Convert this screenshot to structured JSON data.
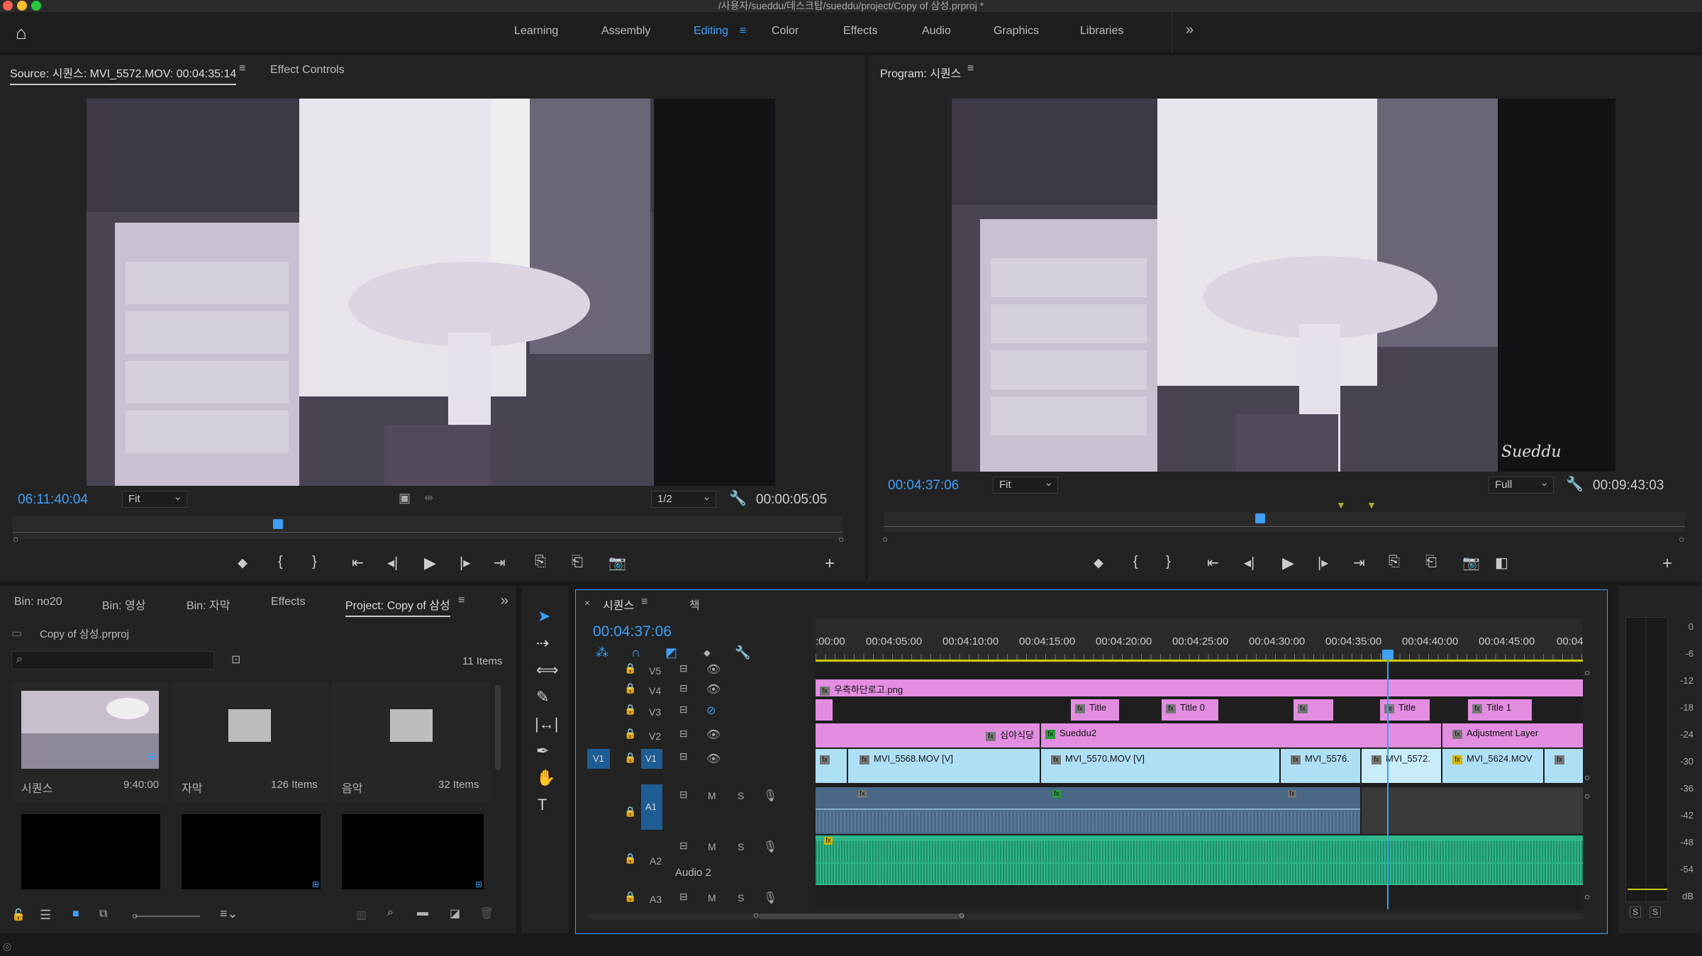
{
  "window": {
    "title": "/사용자/sueddu/데스크탑/sueddu/project/Copy of 삼성.prproj *"
  },
  "workspaces": [
    "Learning",
    "Assembly",
    "Editing",
    "Color",
    "Effects",
    "Audio",
    "Graphics",
    "Libraries"
  ],
  "active_workspace": "Editing",
  "source": {
    "tab_label": "Source: 시퀀스: MVI_5572.MOV: 00:04:35:14",
    "effect_controls_tab": "Effect Controls",
    "timecode": "06:11:40:04",
    "fit": "Fit",
    "resolution": "1/2",
    "duration": "00:00:05:05",
    "playhead_fraction": 0.32
  },
  "program": {
    "tab_label": "Program: 시퀀스",
    "timecode": "00:04:37:06",
    "fit": "Fit",
    "resolution": "Full",
    "duration": "00:09:43:03",
    "playhead_fraction": 0.47,
    "watermark": "Sueddu"
  },
  "project": {
    "tabs": [
      "Bin: no20",
      "Bin: 영상",
      "Bin: 자막",
      "Effects",
      "Project: Copy of 삼성"
    ],
    "active_tab": "Project: Copy of 삼성",
    "file_name": "Copy of 삼성.prproj",
    "search_placeholder": "",
    "item_count": "11 Items",
    "items": [
      {
        "name": "시퀀스",
        "meta": "9:40:00",
        "kind": "sequence"
      },
      {
        "name": "자막",
        "meta": "126 Items",
        "kind": "folder"
      },
      {
        "name": "음악",
        "meta": "32 Items",
        "kind": "folder"
      }
    ]
  },
  "timeline": {
    "tabs": [
      "시퀀스",
      "책"
    ],
    "timecode": "00:04:37:06",
    "ruler": [
      ":00:00",
      "00:04:05:00",
      "00:04:10:00",
      "00:04:15:00",
      "00:04:20:00",
      "00:04:25:00",
      "00:04:30:00",
      "00:04:35:00",
      "00:04:40:00",
      "00:04:45:00",
      "00:04"
    ],
    "tracks": {
      "video": [
        "V5",
        "V4",
        "V3",
        "V2",
        "V1"
      ],
      "audio": [
        "A1",
        "A2",
        "A3"
      ],
      "source_patch": "V1",
      "audio2_name": "Audio 2"
    },
    "clips": {
      "v4": "우측하단로고.png",
      "v3": [
        "Title",
        "Title 0",
        "Title",
        "Title 1"
      ],
      "v2": [
        "심야식당",
        "Sueddu2",
        "Adjustment Layer"
      ],
      "v1": [
        "MVI_5568.MOV [V]",
        "MVI_5570.MOV [V]",
        "MVI_5576.",
        "MVI_5572.",
        "MVI_5624.MOV"
      ]
    },
    "track_buttons": {
      "mute": "M",
      "solo": "S"
    }
  },
  "audio_meter": {
    "scale": [
      "0",
      "-6",
      "-12",
      "-18",
      "-24",
      "-30",
      "-36",
      "-42",
      "-48",
      "-54",
      "dB"
    ],
    "solo_buttons": [
      "S",
      "S"
    ]
  },
  "colors": {
    "accent": "#3f9ff5",
    "clip_pink": "#e28de0",
    "clip_blue": "#aee0f5",
    "audio_green": "#2fb58a",
    "audio_blue": "#4a6785"
  }
}
